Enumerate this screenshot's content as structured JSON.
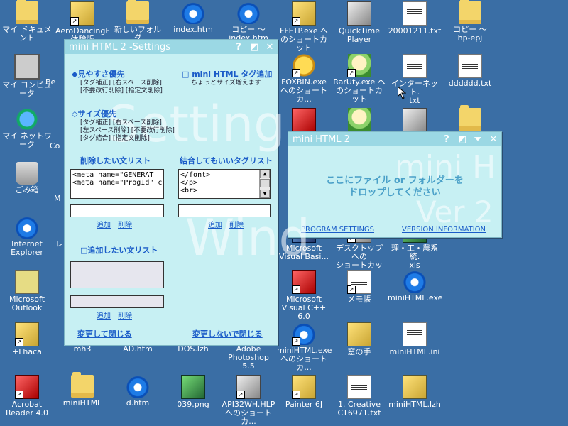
{
  "desktop": {
    "icons": [
      {
        "label": "マイ ドキュメント",
        "type": "folder"
      },
      {
        "label": "AeroDancingF\n体験版",
        "type": "app"
      },
      {
        "label": "新しいフォルダ",
        "type": "folder"
      },
      {
        "label": "index.htm",
        "type": "ie"
      },
      {
        "label": "コピー ～\nindex.htm",
        "type": "ie"
      },
      {
        "label": "FFFTP.exe へ\nのショートカット",
        "type": "app"
      },
      {
        "label": "QuickTime\nPlayer",
        "type": "gray"
      },
      {
        "label": "20001211.txt",
        "type": "doc"
      },
      {
        "label": "コピー ～\nhp-epj",
        "type": "folder"
      },
      {
        "label": "マイ コンピュータ",
        "type": "pc"
      },
      {
        "label": "Be",
        "type": "app"
      },
      {
        "label": "FOXBIN.exe\nへのショートカ...",
        "type": "fox"
      },
      {
        "label": "RarUty.exe へ\nのショートカット",
        "type": "char"
      },
      {
        "label": "インターネット.\ntxt",
        "type": "doc"
      },
      {
        "label": "dddddd.txt",
        "type": "doc"
      },
      {
        "label": "マイ ネットワーク",
        "type": "net"
      },
      {
        "label": "Co",
        "type": "app"
      },
      {
        "label": "ごみ箱",
        "type": "bin"
      },
      {
        "label": "M",
        "type": "app"
      },
      {
        "label": "Internet\nExplorer",
        "type": "ie"
      },
      {
        "label": "レ",
        "type": "app"
      },
      {
        "label": "Microsoft\nVisual Basi...",
        "type": "blue"
      },
      {
        "label": "デスクトップ への\nショートカット",
        "type": "gray"
      },
      {
        "label": "理・工・農系統.\nxls",
        "type": "green"
      },
      {
        "label": "Microsoft\nOutlook",
        "type": "outlook"
      },
      {
        "label": "Microsoft\nVisual C++ 6.0",
        "type": "red"
      },
      {
        "label": "メモ帳",
        "type": "doc"
      },
      {
        "label": "miniHTML.exe",
        "type": "ie"
      },
      {
        "label": "+Lhaca",
        "type": "app"
      },
      {
        "label": "mh3",
        "type": "app"
      },
      {
        "label": "AD.htm",
        "type": "ie"
      },
      {
        "label": "DOS.lzh",
        "type": "app"
      },
      {
        "label": "Adobe\nPhotoshop 5.5",
        "type": "blue"
      },
      {
        "label": "miniHTML.exe\nへのショートカ...",
        "type": "ie"
      },
      {
        "label": "窓の手",
        "type": "app"
      },
      {
        "label": "miniHTML.ini",
        "type": "doc"
      },
      {
        "label": "Acrobat\nReader 4.0",
        "type": "red"
      },
      {
        "label": "miniHTML",
        "type": "folder"
      },
      {
        "label": "d.htm",
        "type": "ie"
      },
      {
        "label": "039.png",
        "type": "green"
      },
      {
        "label": "API32WH.HLP\nへのショートカ...",
        "type": "gray"
      },
      {
        "label": "Painter 6J",
        "type": "app"
      },
      {
        "label": "1. Creative\nCT6971.txt",
        "type": "doc"
      },
      {
        "label": "miniHTML.lzh",
        "type": "app"
      }
    ]
  },
  "settings": {
    "title": "mini HTML 2 -Settings",
    "help": "?",
    "close": "✕",
    "watermark1": "Setting",
    "watermark2": "Wind",
    "view": {
      "title": "◆見やすさ優先",
      "line1": "[タグ補正] [右スペース削除]",
      "line2": "[不要改行削除] [指定文削除]"
    },
    "tagadd": {
      "title": "□ mini HTML タグ追加",
      "sub": "ちょっとサイズ増えます"
    },
    "size": {
      "title": "◇サイズ優先",
      "line1": "[タグ補正] [右スペース削除]",
      "line2": "[左スペース削除] [不要改行削除]",
      "line3": "[タグ結合] [指定文削除]"
    },
    "delete_list": {
      "label": "削除したい文リスト",
      "items": [
        "<meta name=\"GENERAT",
        "<meta name=\"ProgId\" co"
      ],
      "add": "追加",
      "remove": "削除"
    },
    "join_list": {
      "label": "結合してもいいタグリスト",
      "items": [
        "</font>",
        "</p>",
        "<br>"
      ],
      "add": "追加",
      "remove": "削除"
    },
    "add_list": {
      "label": "□追加したい文リスト",
      "add": "追加",
      "remove": "削除"
    },
    "ok": "変更して閉じる",
    "cancel": "変更しないで閉じる"
  },
  "minihtml": {
    "title": "mini HTML 2",
    "help": "?",
    "close": "✕",
    "watermark1": "mini H",
    "watermark2": "Ver 2",
    "drop_line1": "ここにファイル or フォルダーを",
    "drop_line2": "ドロップしてください",
    "program_settings": "PROGRAM SETTINGS",
    "version_info": "VERSION INFORMATION"
  }
}
